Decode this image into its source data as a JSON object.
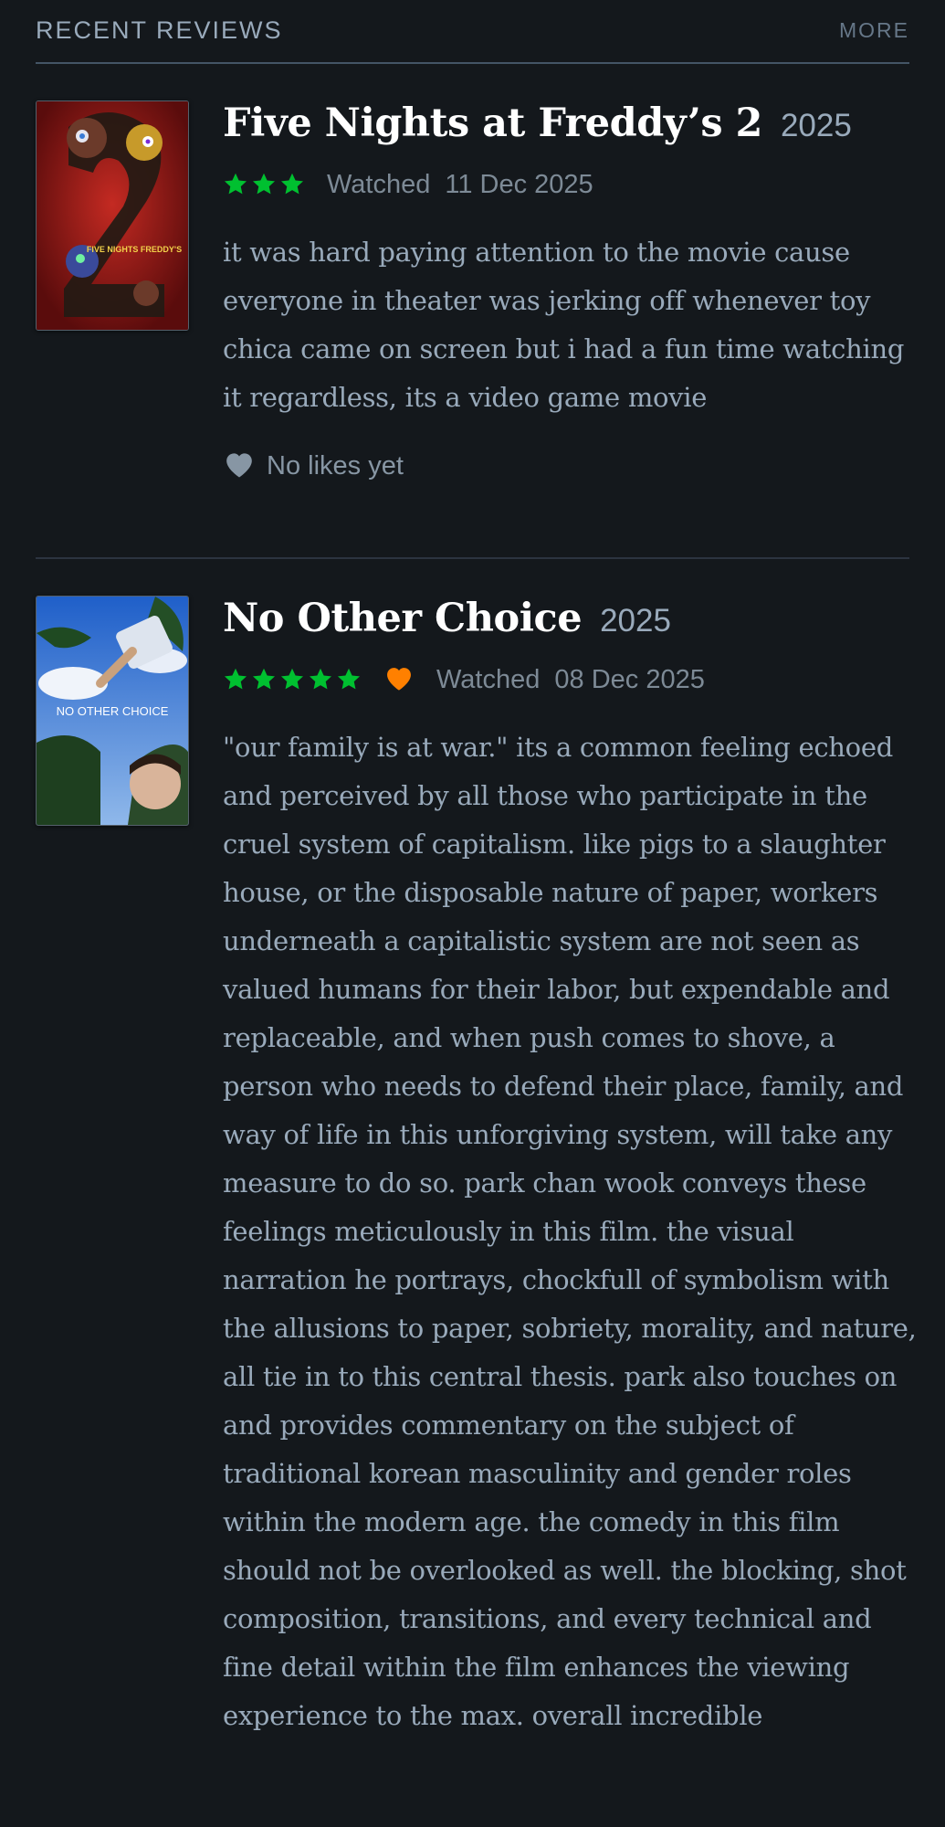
{
  "section": {
    "title": "RECENT REVIEWS",
    "more_label": "MORE"
  },
  "reviews": [
    {
      "title": "Five Nights at Freddy’s 2",
      "year": "2025",
      "rating_stars": 3,
      "liked": false,
      "watched_label": "Watched",
      "watched_date": "11 Dec 2025",
      "text": "it was hard paying attention to the movie cause everyone in theater was jerking off whenever toy chica came on screen but i had a fun time watching it regardless, its a video game movie",
      "likes_text": "No likes yet",
      "poster_caption": "FIVE NIGHTS FREDDY'S"
    },
    {
      "title": "No Other Choice",
      "year": "2025",
      "rating_stars": 5,
      "liked": true,
      "watched_label": "Watched",
      "watched_date": "08 Dec 2025",
      "text": "\"our family is at war.\" its a common feeling echoed and perceived by all those who participate in the cruel system of capitalism. like pigs to a slaughter house, or the disposable nature of paper, workers underneath a capitalistic system are not seen as valued humans for their labor, but expendable and replaceable, and when push comes to shove, a person who needs to defend their place, family, and way of life in this unforgiving system, will take any measure to do so. park chan wook conveys these feelings meticulously in this film. the visual narration he portrays, chockfull of symbolism with the allusions to paper, sobriety, morality, and nature, all tie in to this central thesis. park also touches on and provides commentary on the subject of traditional korean masculinity and gender roles within the modern age. the comedy in this film should not be overlooked as well. the blocking, shot composition, transitions, and every technical and fine detail within the film enhances the viewing experience to the max. overall incredible",
      "poster_caption": "NO OTHER CHOICE"
    }
  ],
  "colors": {
    "background": "#14181c",
    "star_green": "#00c030",
    "like_orange": "#ff8000",
    "heart_grey": "#8796a4"
  }
}
